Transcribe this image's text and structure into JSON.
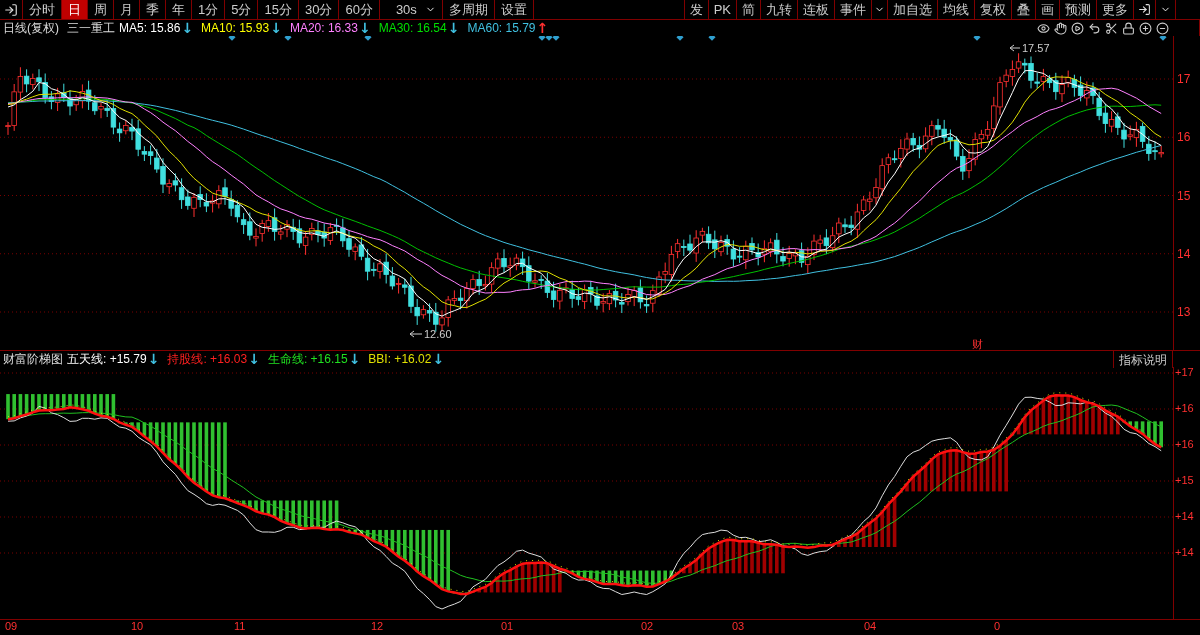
{
  "toolbar": {
    "left": [
      {
        "kind": "tab",
        "label": "分时",
        "selected": false
      },
      {
        "kind": "tab",
        "label": "日",
        "selected": true
      },
      {
        "kind": "tab",
        "label": "周",
        "selected": false
      },
      {
        "kind": "tab",
        "label": "月",
        "selected": false
      },
      {
        "kind": "tab",
        "label": "季",
        "selected": false
      },
      {
        "kind": "tab",
        "label": "年",
        "selected": false
      },
      {
        "kind": "tab",
        "label": "1分",
        "selected": false
      },
      {
        "kind": "tab",
        "label": "5分",
        "selected": false
      },
      {
        "kind": "tab",
        "label": "15分",
        "selected": false
      },
      {
        "kind": "tab",
        "label": "30分",
        "selected": false
      },
      {
        "kind": "tab",
        "label": "60分",
        "selected": false
      },
      {
        "kind": "dropdown",
        "label": "30s",
        "selected": false
      },
      {
        "kind": "tab",
        "label": "多周期",
        "selected": false
      },
      {
        "kind": "tab",
        "label": "设置",
        "selected": false
      }
    ],
    "right": [
      {
        "kind": "button",
        "label": "发"
      },
      {
        "kind": "button",
        "label": "PK"
      },
      {
        "kind": "button",
        "label": "简"
      },
      {
        "kind": "button",
        "label": "九转"
      },
      {
        "kind": "button",
        "label": "连板"
      },
      {
        "kind": "button",
        "label": "事件"
      },
      {
        "kind": "dropdown"
      },
      {
        "kind": "button",
        "label": "加自选"
      },
      {
        "kind": "button",
        "label": "均线"
      },
      {
        "kind": "button",
        "label": "复权"
      },
      {
        "kind": "button",
        "label": "叠"
      },
      {
        "kind": "button",
        "label": "画"
      },
      {
        "kind": "button",
        "label": "预测"
      },
      {
        "kind": "button",
        "label": "更多"
      }
    ]
  },
  "legend": {
    "title": "日线(复权)",
    "stock": "三一重工",
    "items": [
      {
        "label": "MA5: 15.86",
        "arrow": {
          "text": "↓",
          "color": "#40c0e0"
        },
        "color": "#ffffff"
      },
      {
        "label": "MA10: 15.93",
        "arrow": {
          "text": "↓",
          "color": "#40c0e0"
        },
        "color": "#ffff00"
      },
      {
        "label": "MA20: 16.33",
        "arrow": {
          "text": "↓",
          "color": "#40c0e0"
        },
        "color": "#ff80ff"
      },
      {
        "label": "MA30: 16.54",
        "arrow": {
          "text": "↓",
          "color": "#40c0e0"
        },
        "color": "#00e000"
      },
      {
        "label": "MA60: 15.79",
        "arrow": {
          "text": "↑",
          "color": "#ff3030"
        },
        "color": "#40c0e0"
      }
    ]
  },
  "main_chart": {
    "price_axis": [
      "17",
      "16",
      "15",
      "14",
      "13"
    ],
    "high_label": "17.57",
    "low_label": "12.60",
    "event_marker": "财"
  },
  "indicator": {
    "title": "财富阶梯图",
    "items": [
      {
        "label": "五天线: +15.79",
        "arrow": {
          "text": "↓",
          "color": "#40c0e0"
        },
        "color": "#ffffff"
      },
      {
        "label": "持股线: +16.03",
        "arrow": {
          "text": "↓",
          "color": "#40c0e0"
        },
        "color": "#ff2020"
      },
      {
        "label": "生命线: +16.15",
        "arrow": {
          "text": "↓",
          "color": "#40c0e0"
        },
        "color": "#20e020"
      },
      {
        "label": "BBI: +16.02",
        "arrow": {
          "text": "↓",
          "color": "#40c0e0"
        },
        "color": "#e0e000"
      }
    ],
    "button": "指标说明",
    "axis": [
      "+17",
      "+16",
      "+16",
      "+15",
      "+14",
      "+14"
    ]
  },
  "date_axis": [
    "09",
    "10",
    "11",
    "12",
    "01",
    "02",
    "03",
    "04",
    "0"
  ]
}
